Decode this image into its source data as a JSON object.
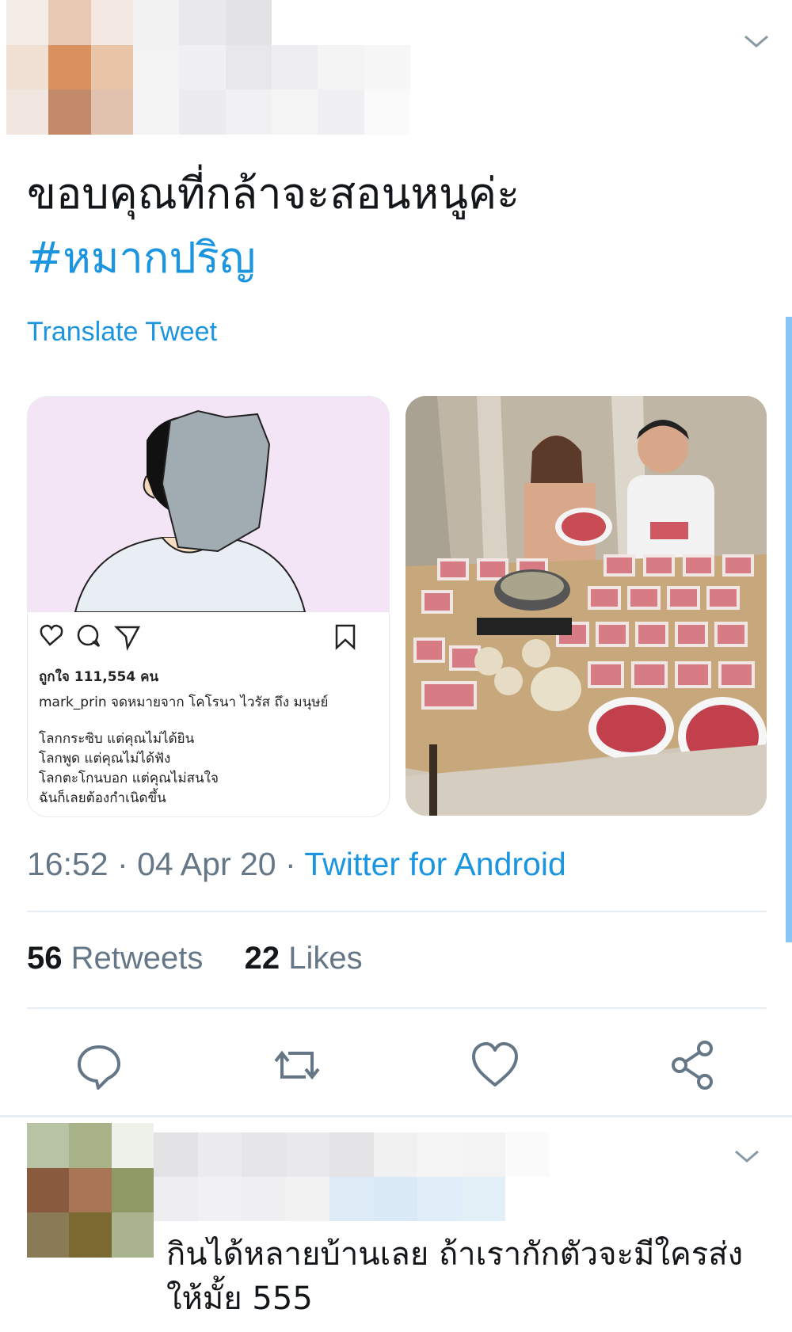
{
  "tweet": {
    "text": "ขอบคุณที่กล้าจะสอนหนูค่ะ",
    "hashtag": "#หมากปริญ",
    "translate_label": "Translate Tweet",
    "time": "16:52",
    "date": "04 Apr 20",
    "source": "Twitter for Android",
    "separator": "·"
  },
  "media_left": {
    "likes_line": "ถูกใจ 111,554 คน",
    "caption_line": "mark_prin จดหมายจาก โคโรนา ไวรัส ถึง มนุษย์",
    "body_lines": [
      "โลกกระซิบ แต่คุณไม่ได้ยิน",
      "โลกพูด แต่คุณไม่ได้ฟัง",
      "โลกตะโกนบอก แต่คุณไม่สนใจ",
      "ฉันก็เลยต้องกำเนิดขึ้น"
    ]
  },
  "stats": {
    "retweets_count": "56",
    "retweets_label": "Retweets",
    "likes_count": "22",
    "likes_label": "Likes"
  },
  "actions": {
    "reply_icon": "reply-icon",
    "retweet_icon": "retweet-icon",
    "like_icon": "heart-icon",
    "share_icon": "share-icon"
  },
  "reply": {
    "text": "กินได้หลายบ้านเลย ถ้าเรากักตัวจะมีใครส่งให้มั้ย 555"
  },
  "colors": {
    "accent": "#1b95e0",
    "text": "#14171a",
    "muted": "#657786",
    "divider": "#e6ecf0"
  }
}
